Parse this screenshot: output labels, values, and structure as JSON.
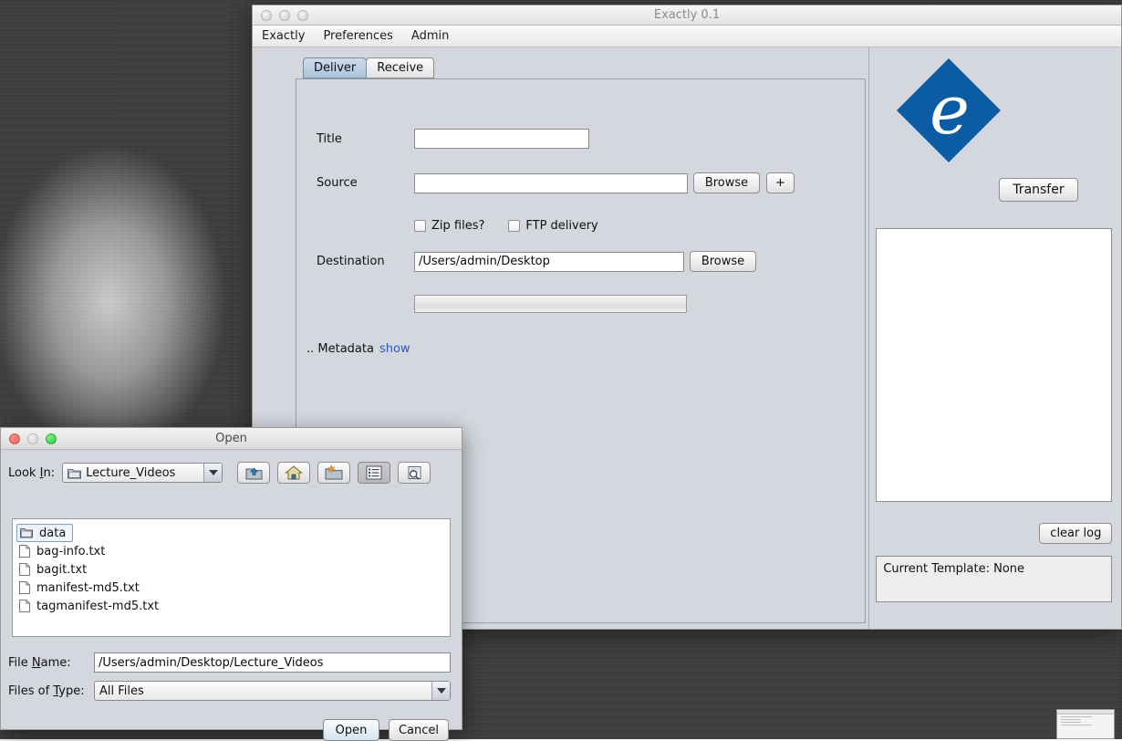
{
  "desktop": {
    "wallpaper_description": "grainy black-and-white photograph"
  },
  "main_window": {
    "title": "Exactly 0.1",
    "traffic_lights": [
      "close-inactive",
      "minimize-inactive",
      "zoom-inactive"
    ],
    "menu": [
      {
        "label": "Exactly"
      },
      {
        "label": "Preferences"
      },
      {
        "label": "Admin"
      }
    ],
    "tabs": [
      {
        "label": "Deliver",
        "selected": true
      },
      {
        "label": "Receive",
        "selected": false
      }
    ],
    "form": {
      "title_label": "Title",
      "title_value": "",
      "source_label": "Source",
      "source_value": "",
      "source_browse_label": "Browse",
      "source_add_label": "+",
      "zip_checkbox_label": "Zip files?",
      "zip_checked": false,
      "ftp_checkbox_label": "FTP delivery",
      "ftp_checked": false,
      "destination_label": "Destination",
      "destination_value": "/Users/admin/Desktop",
      "destination_browse_label": "Browse",
      "progress_value": 0,
      "metadata_prefix": ".. Metadata",
      "metadata_toggle_label": "show"
    },
    "sidebar": {
      "logo_letter": "e",
      "logo_color": "#0b5ca5",
      "transfer_label": "Transfer",
      "log_content": "",
      "clear_log_label": "clear log",
      "template_text": "Current Template: None"
    }
  },
  "open_dialog": {
    "title": "Open",
    "traffic_lights": [
      "close",
      "minimize-disabled",
      "zoom"
    ],
    "look_in_label": "Look In:",
    "look_in_mnemonic": "I",
    "look_in_value": "Lecture_Videos",
    "toolbar_icons": [
      "up-one-level-icon",
      "home-icon",
      "new-folder-icon",
      "list-view-icon",
      "details-view-icon"
    ],
    "files": [
      {
        "name": "data",
        "type": "folder",
        "selected": true
      },
      {
        "name": "bag-info.txt",
        "type": "file",
        "selected": false
      },
      {
        "name": "bagit.txt",
        "type": "file",
        "selected": false
      },
      {
        "name": "manifest-md5.txt",
        "type": "file",
        "selected": false
      },
      {
        "name": "tagmanifest-md5.txt",
        "type": "file",
        "selected": false
      }
    ],
    "file_name_label_pre": "File ",
    "file_name_mnemonic": "N",
    "file_name_label_post": "ame:",
    "file_name_value": "/Users/admin/Desktop/Lecture_Videos",
    "file_type_label_pre": "Files of ",
    "file_type_mnemonic": "T",
    "file_type_label_post": "ype:",
    "file_type_value": "All Files",
    "open_label": "Open",
    "cancel_label": "Cancel"
  }
}
